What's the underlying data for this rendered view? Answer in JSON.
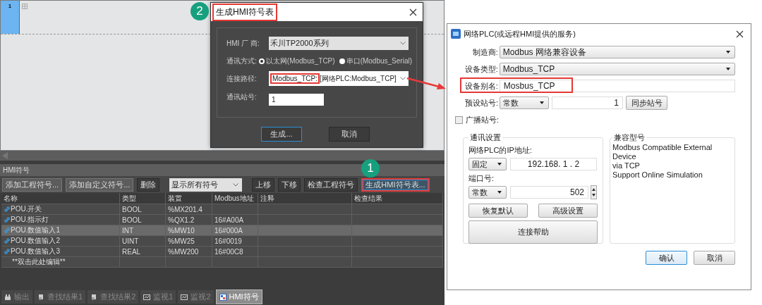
{
  "editor": {
    "rung_number": "1"
  },
  "generate_dialog": {
    "step": "2",
    "title": "生成HMI符号表",
    "title_highlighted": true,
    "rows": [
      {
        "kind": "select",
        "label": "HMI 厂 商:",
        "value": "禾川TP2000系列"
      },
      {
        "kind": "radio",
        "label": "通讯方式:",
        "options": [
          {
            "label": "以太网(Modbus_TCP)",
            "selected": true
          },
          {
            "label": "串口(Modbus_Serial)",
            "selected": false
          }
        ]
      },
      {
        "kind": "path",
        "label": "连接路径:",
        "marked": "Modbus_TCP:",
        "value": "[网络PLC:Modbus_TCP]"
      },
      {
        "kind": "input",
        "label": "通讯站号:",
        "value": "1"
      }
    ],
    "buttons": [
      {
        "label": "生成...",
        "default": true
      },
      {
        "label": "取消",
        "default": false
      }
    ]
  },
  "hmi_panel": {
    "title": "HMI符号",
    "toolbar": [
      {
        "kind": "button",
        "label": "添加工程符号...",
        "highlighted": false
      },
      {
        "kind": "button",
        "label": "添加自定义符号...",
        "highlighted": false
      },
      {
        "kind": "button",
        "label": "删除",
        "highlighted": false
      },
      {
        "kind": "dropdown",
        "label": "显示所有符号"
      },
      {
        "kind": "button",
        "label": "上移",
        "highlighted": false
      },
      {
        "kind": "button",
        "label": "下移",
        "highlighted": false
      },
      {
        "kind": "button",
        "label": "检查工程符号",
        "highlighted": false
      },
      {
        "kind": "button",
        "label": "生成HMI符号表...",
        "highlighted": true,
        "step": "1"
      }
    ],
    "columns": [
      "名称",
      "类型",
      "装置",
      "Modbus地址",
      "注释",
      "检查结果"
    ],
    "rows": [
      {
        "kind": "symbol",
        "name": "POU.开关",
        "type": "BOOL",
        "device": "%MX201.4",
        "selected": false
      },
      {
        "kind": "symbol",
        "name": "POU.指示灯",
        "type": "BOOL",
        "device": "%QX1.2",
        "modbus_address": "16#A00A",
        "selected": false
      },
      {
        "kind": "symbol",
        "name": "POU.数值输入1",
        "type": "INT",
        "device": "%MW10",
        "modbus_address": "16#000A",
        "selected": true
      },
      {
        "kind": "symbol",
        "name": "POU.数值输入2",
        "type": "UINT",
        "device": "%MW25",
        "modbus_address": "16#0019",
        "selected": false
      },
      {
        "kind": "symbol",
        "name": "POU.数值输入3",
        "type": "REAL",
        "device": "%MW200",
        "modbus_address": "16#00C8",
        "selected": false
      },
      {
        "kind": "new",
        "name": "**双击此处编辑**",
        "selected": false
      }
    ]
  },
  "bottom_tabs": [
    {
      "label": "输出",
      "selected": false
    },
    {
      "label": "查找结果1",
      "selected": false
    },
    {
      "label": "查找结果2",
      "selected": false
    },
    {
      "label": "监视1",
      "selected": false
    },
    {
      "label": "监视2",
      "selected": false
    },
    {
      "label": "HMI符号",
      "selected": true
    }
  ],
  "device_dialog": {
    "title": "网络PLC(或远程HMI提供的服务)",
    "manufacturer": {
      "label": "制造商:",
      "value": "Modbus 网络兼容设备"
    },
    "device_type": {
      "label": "设备类型:",
      "value": "Modbus_TCP"
    },
    "alias": {
      "label": "设备别名:",
      "value": "Mosbus_TCP",
      "highlighted": true
    },
    "station": {
      "label": "预设站号:",
      "mode": "常数",
      "value": "1",
      "button": "同步站号"
    },
    "broadcast": {
      "label": "广播站号:",
      "checked": false
    },
    "comm_settings": {
      "title": "通讯设置",
      "ip_label": "网络PLC的IP地址:",
      "ip_mode": "固定",
      "ip": "192.168. 1 . 2",
      "port_label": "端口号:",
      "port_mode": "常数",
      "port": "502",
      "buttons": [
        "恢复默认",
        "高级设置"
      ],
      "help_button": "连接帮助"
    },
    "compatible": {
      "title": "兼容型号",
      "lines": [
        "Modbus Compatible External Device",
        "via TCP",
        "Support Online Simulation"
      ]
    },
    "buttons": [
      {
        "label": "确认",
        "default": true
      },
      {
        "label": "取消",
        "default": false
      }
    ]
  }
}
